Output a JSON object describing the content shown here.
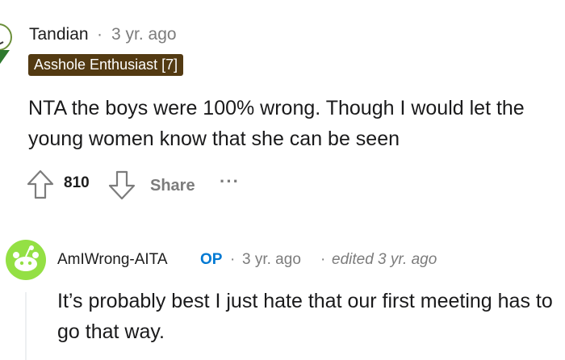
{
  "comment": {
    "author": "Tandian",
    "separator": "·",
    "time": "3 yr. ago",
    "flair": "Asshole Enthusiast [7]",
    "body": "NTA the boys were 100% wrong. Though I would let the young women know that she can be seen",
    "actions": {
      "upvote_icon": "upvote-arrow-icon",
      "votes": "810",
      "downvote_icon": "downvote-arrow-icon",
      "share_label": "Share",
      "more_label": "···"
    }
  },
  "reply": {
    "author": "AmIWrong-AITA",
    "op_badge": "OP",
    "separator": "·",
    "time": "3 yr. ago",
    "edited": "edited 3 yr. ago",
    "body": "It’s probably best I just hate that our first meeting has to go that way."
  },
  "colors": {
    "flair_bg": "#533a12",
    "op_blue": "#0079d3",
    "meta_gray": "#7c7c7c",
    "avatar_green": "#94e044"
  }
}
